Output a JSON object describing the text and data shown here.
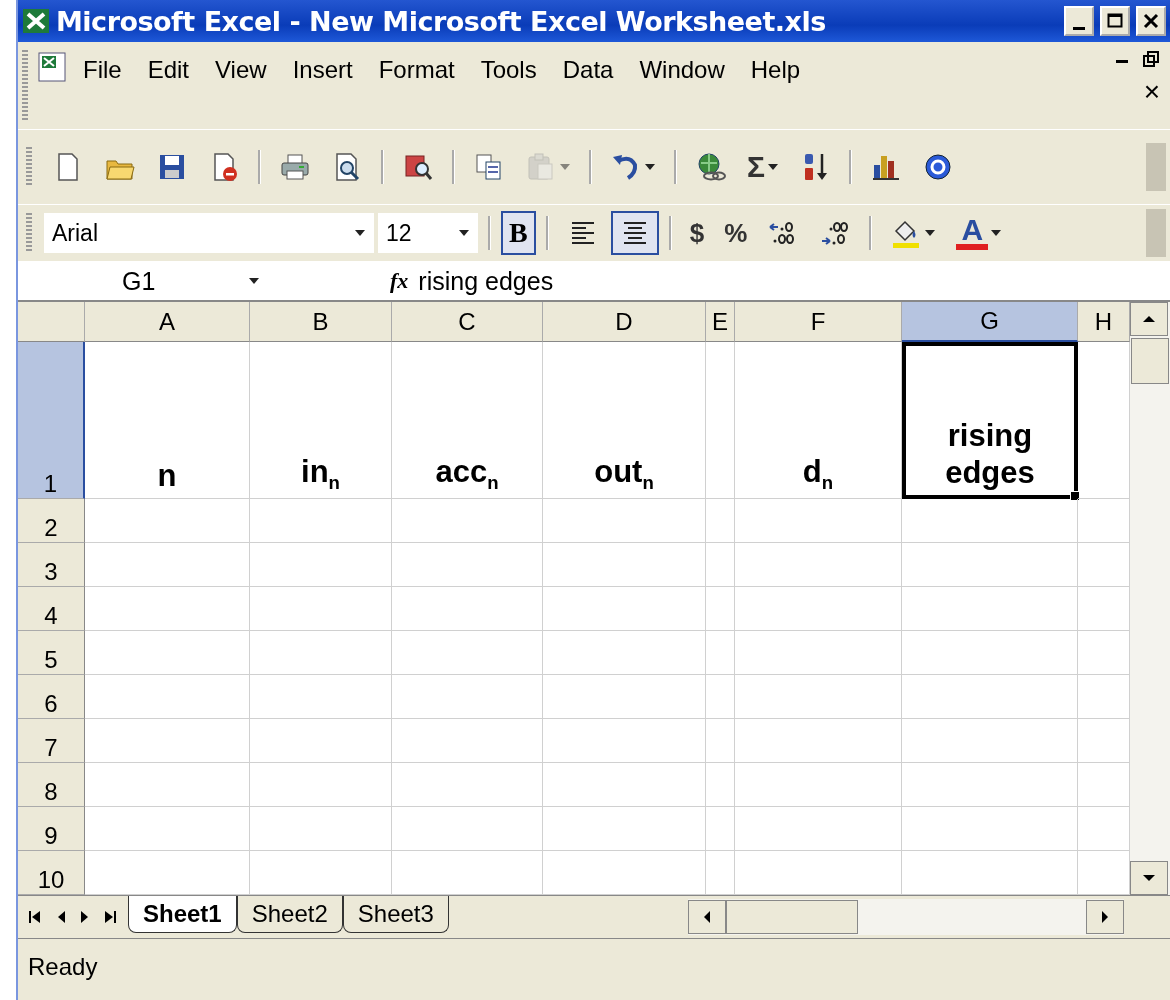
{
  "window": {
    "title": "Microsoft Excel - New Microsoft Excel Worksheet.xls"
  },
  "menu": [
    {
      "label": "File"
    },
    {
      "label": "Edit"
    },
    {
      "label": "View"
    },
    {
      "label": "Insert"
    },
    {
      "label": "Format"
    },
    {
      "label": "Tools"
    },
    {
      "label": "Data"
    },
    {
      "label": "Window"
    },
    {
      "label": "Help"
    }
  ],
  "menu_close_glyph": "×",
  "standard_toolbar": [
    {
      "kind": "new"
    },
    {
      "kind": "open"
    },
    {
      "kind": "save"
    },
    {
      "kind": "permission"
    },
    {
      "kind": "separator"
    },
    {
      "kind": "print"
    },
    {
      "kind": "preview"
    },
    {
      "kind": "separator"
    },
    {
      "kind": "research"
    },
    {
      "kind": "separator"
    },
    {
      "kind": "copy"
    },
    {
      "kind": "paste",
      "disabled": true,
      "dropdown": true
    },
    {
      "kind": "separator"
    },
    {
      "kind": "undo",
      "dropdown": true
    },
    {
      "kind": "separator"
    },
    {
      "kind": "hyperlink"
    },
    {
      "kind": "autosum",
      "glyph": "Σ",
      "dropdown": true
    },
    {
      "kind": "sort"
    },
    {
      "kind": "separator"
    },
    {
      "kind": "chart"
    },
    {
      "kind": "help"
    }
  ],
  "format_toolbar": {
    "font": "Arial",
    "size": "12",
    "items": [
      {
        "kind": "bold",
        "glyph": "B",
        "selected": true
      },
      {
        "kind": "separator"
      },
      {
        "kind": "align-left",
        "selected": false
      },
      {
        "kind": "align-center",
        "selected": true
      },
      {
        "kind": "separator"
      },
      {
        "kind": "currency",
        "glyph": "$"
      },
      {
        "kind": "percent",
        "glyph": "%"
      },
      {
        "kind": "increase-decimal"
      },
      {
        "kind": "decrease-decimal"
      },
      {
        "kind": "separator"
      },
      {
        "kind": "fill-color",
        "color": "#f0e000",
        "dropdown": true
      },
      {
        "kind": "font-color",
        "glyph": "A",
        "color": "#e02020",
        "dropdown": true
      }
    ]
  },
  "formula_bar": {
    "name_box": "G1",
    "fx": "fx",
    "formula": "rising edges"
  },
  "sheet": {
    "columns": [
      {
        "label": "A",
        "selected": false
      },
      {
        "label": "B",
        "selected": false
      },
      {
        "label": "C",
        "selected": false
      },
      {
        "label": "D",
        "selected": false
      },
      {
        "label": "E",
        "selected": false
      },
      {
        "label": "F",
        "selected": false
      },
      {
        "label": "G",
        "selected": true
      },
      {
        "label": "H",
        "selected": false
      }
    ],
    "rows": [
      {
        "header": "1",
        "selected": true,
        "cells": [
          "n",
          "in$_{n}$",
          "acc$_{n}$",
          "out$_{n}$",
          null,
          "d$_{n}$",
          "rising edges",
          null
        ]
      },
      {
        "header": "2",
        "selected": false
      },
      {
        "header": "3",
        "selected": false
      },
      {
        "header": "4",
        "selected": false
      },
      {
        "header": "5",
        "selected": false
      },
      {
        "header": "6",
        "selected": false
      },
      {
        "header": "7",
        "selected": false
      },
      {
        "header": "8",
        "selected": false
      },
      {
        "header": "9",
        "selected": false
      },
      {
        "header": "10",
        "selected": false
      }
    ]
  },
  "sheet_tabs": [
    {
      "label": "Sheet1",
      "selected": true
    },
    {
      "label": "Sheet2",
      "selected": false
    },
    {
      "label": "Sheet3",
      "selected": false
    }
  ],
  "status_bar": {
    "text": "Ready"
  }
}
